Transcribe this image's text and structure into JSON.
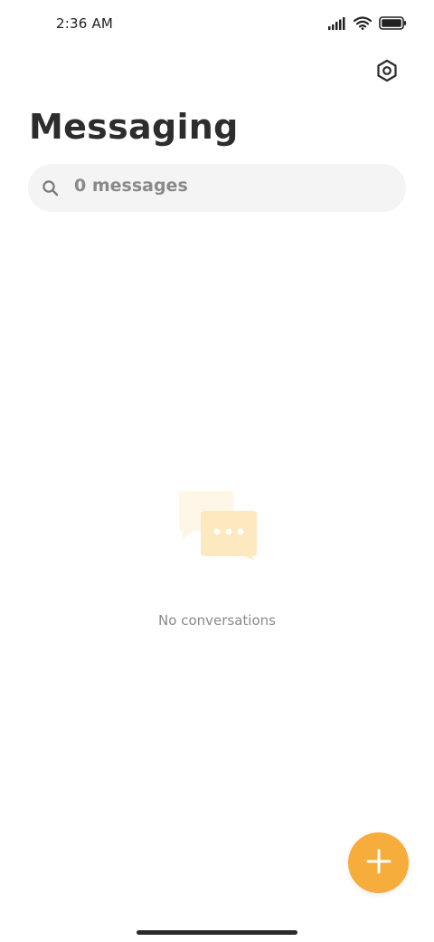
{
  "status_bar": {
    "time": "2:36 AM",
    "icons": [
      "signal-icon",
      "wifi-icon",
      "battery-icon"
    ]
  },
  "header": {
    "settings_icon": "settings-icon",
    "title": "Messaging"
  },
  "search": {
    "icon": "search-icon",
    "text": "0 messages"
  },
  "empty_state": {
    "illustration": "chat-bubbles-icon",
    "text": "No conversations"
  },
  "fab": {
    "icon": "plus-icon",
    "color": "#f6ad3c"
  },
  "colors": {
    "accent": "#f6ad3c",
    "search_bg": "#f4f4f4",
    "muted_text": "#8a8a8a"
  }
}
